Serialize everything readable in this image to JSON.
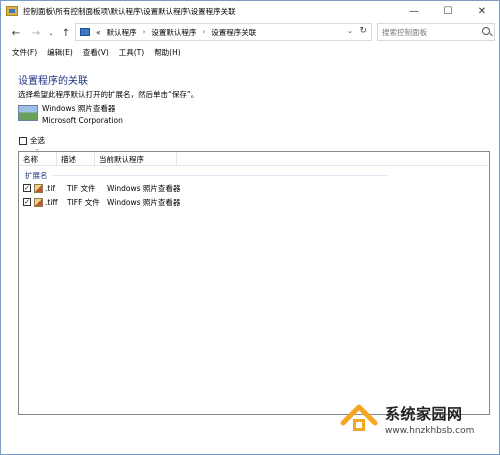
{
  "window": {
    "title": "控制面板\\所有控制面板项\\默认程序\\设置默认程序\\设置程序关联",
    "controls": {
      "minimize": "—",
      "maximize": "☐",
      "close": "✕"
    }
  },
  "nav": {
    "back": "←",
    "forward": "→",
    "dropdown": "⌄",
    "up": "↑"
  },
  "address": {
    "overflow": "«",
    "breadcrumbs": [
      "默认程序",
      "设置默认程序",
      "设置程序关联"
    ],
    "separator": "›",
    "dropdown_glyph": "⌄",
    "refresh_glyph": "↻"
  },
  "search": {
    "placeholder": "搜索控制面板"
  },
  "menu": [
    "文件(F)",
    "编辑(E)",
    "查看(V)",
    "工具(T)",
    "帮助(H)"
  ],
  "page": {
    "heading": "设置程序的关联",
    "instruction": "选择希望此程序默认打开的扩展名，然后单击“保存”。",
    "program_name": "Windows 照片查看器",
    "program_company": "Microsoft Corporation",
    "select_all": "全选"
  },
  "list": {
    "columns": [
      "名称",
      "描述",
      "当前默认程序"
    ],
    "group": "扩展名",
    "check_glyph": "✓",
    "rows": [
      {
        "ext": ".tif",
        "desc": "TIF 文件",
        "prog": "Windows 照片查看器",
        "checked": true
      },
      {
        "ext": ".tiff",
        "desc": "TIFF 文件",
        "prog": "Windows 照片查看器",
        "checked": true
      }
    ]
  },
  "watermark": {
    "name": "系统家园网",
    "url": "www.hnzkhbsb.com"
  },
  "colors": {
    "heading": "#1e3287",
    "border": "#7a9cc4",
    "watermark_house": "#f5a623"
  }
}
